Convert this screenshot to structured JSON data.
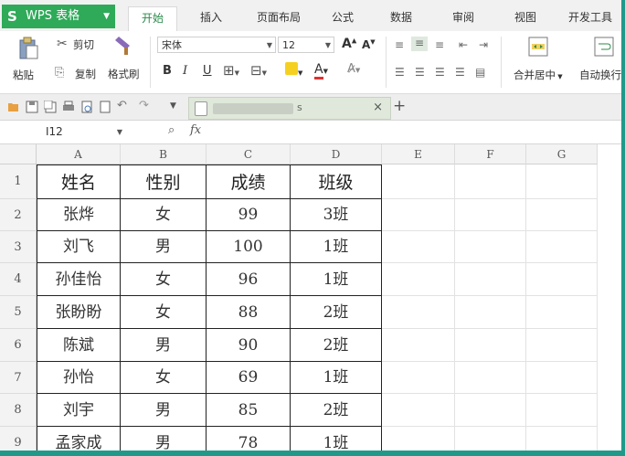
{
  "app": {
    "logo": "S",
    "name": "WPS 表格",
    "dropdown": "▼"
  },
  "tabs": [
    {
      "label": "开始",
      "active": true
    },
    {
      "label": "插入",
      "active": false
    },
    {
      "label": "页面布局",
      "active": false
    },
    {
      "label": "公式",
      "active": false
    },
    {
      "label": "数据",
      "active": false
    },
    {
      "label": "审阅",
      "active": false
    },
    {
      "label": "视图",
      "active": false
    },
    {
      "label": "开发工具",
      "active": false
    }
  ],
  "ribbon": {
    "cut": "剪切",
    "paste": "粘贴",
    "copy": "复制",
    "format_painter": "格式刷",
    "font_name": "宋体",
    "font_size": "12",
    "grow_font": "A",
    "shrink_font": "A",
    "bold": "B",
    "italic": "I",
    "underline": "U",
    "merge_center": "合并居中",
    "auto_wrap": "自动换行"
  },
  "document_tab": {
    "filename_tail": "s",
    "close": "×",
    "add": "+"
  },
  "formula_bar": {
    "cell_ref": "I12",
    "zoom_icon": "🔍",
    "fx": "fx",
    "value": ""
  },
  "columns": [
    "A",
    "B",
    "C",
    "D",
    "E",
    "F",
    "G"
  ],
  "rows": [
    "1",
    "2",
    "3",
    "4",
    "5",
    "6",
    "7",
    "8",
    "9"
  ],
  "table": {
    "headers": [
      "姓名",
      "性别",
      "成绩",
      "班级"
    ],
    "records": [
      [
        "张烨",
        "女",
        "99",
        "3班"
      ],
      [
        "刘飞",
        "男",
        "100",
        "1班"
      ],
      [
        "孙佳怡",
        "女",
        "96",
        "1班"
      ],
      [
        "张盼盼",
        "女",
        "88",
        "2班"
      ],
      [
        "陈斌",
        "男",
        "90",
        "2班"
      ],
      [
        "孙怡",
        "女",
        "69",
        "1班"
      ],
      [
        "刘宇",
        "男",
        "85",
        "2班"
      ],
      [
        "孟家成",
        "男",
        "78",
        "1班"
      ]
    ]
  },
  "colors": {
    "brand": "#2eaa59",
    "active_tab_text": "#2a8a4a"
  }
}
